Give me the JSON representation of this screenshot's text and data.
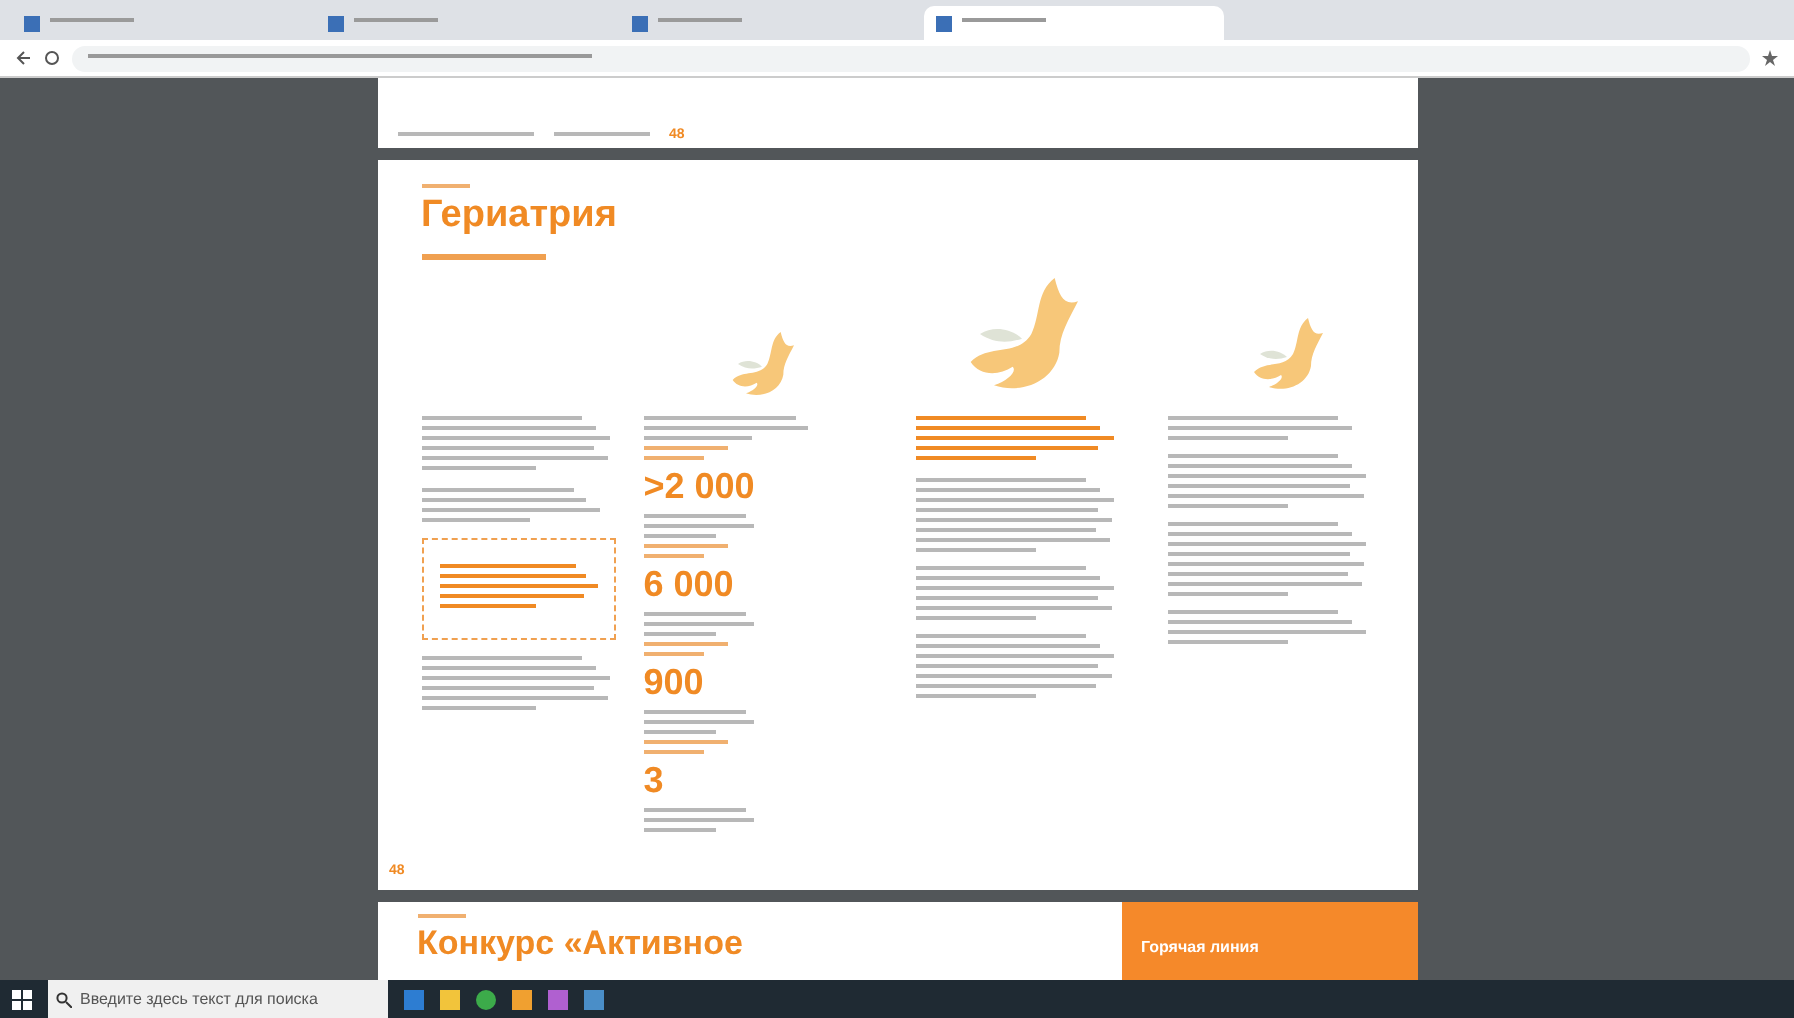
{
  "browser": {
    "tabs": [
      {
        "selected": false
      },
      {
        "selected": false
      },
      {
        "selected": false
      },
      {
        "selected": true
      }
    ]
  },
  "document": {
    "top_page": {
      "page_number": "48"
    },
    "geriatrics_page": {
      "title": "Гериатрия",
      "stats": [
        {
          "value": ">2 000"
        },
        {
          "value": "6 000"
        },
        {
          "value": "900"
        },
        {
          "value": "3"
        }
      ],
      "page_number": "48"
    },
    "next_page": {
      "title": "Конкурс «Активное",
      "side_panel": "Горячая линия"
    }
  },
  "taskbar": {
    "search_placeholder": "Введите здесь текст для поиска"
  }
}
